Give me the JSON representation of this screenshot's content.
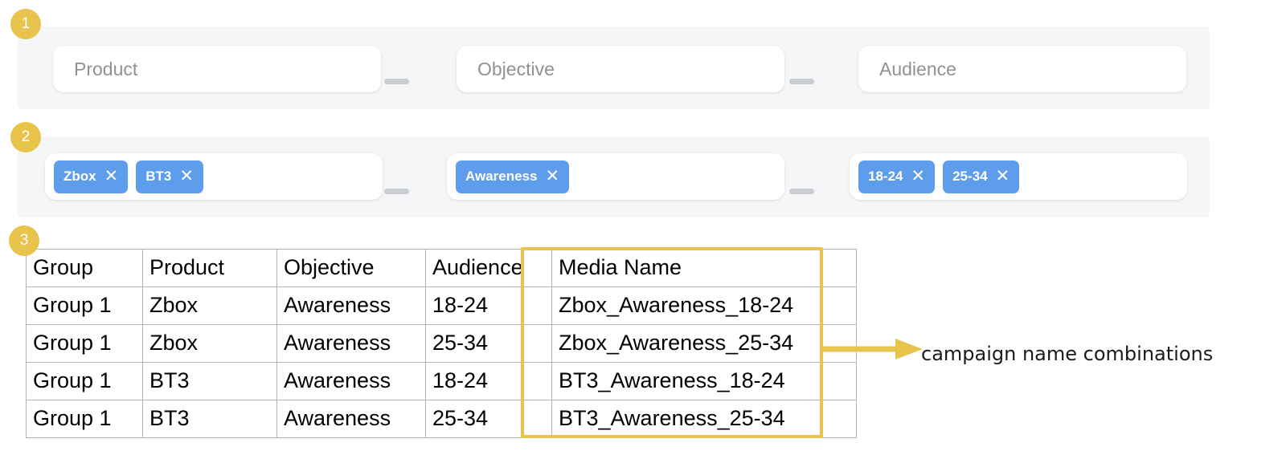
{
  "steps": [
    {
      "number": "1"
    },
    {
      "number": "2"
    },
    {
      "number": "3"
    }
  ],
  "colors": {
    "accent_yellow": "#e8c44c",
    "chip_blue": "#5e9cec",
    "panel_gray": "#f5f6f8",
    "placeholder_gray": "#8e9196",
    "table_border": "#b4b4b4"
  },
  "builder_row_empty": {
    "fields": [
      {
        "name": "product",
        "placeholder": "Product"
      },
      {
        "name": "objective",
        "placeholder": "Objective"
      },
      {
        "name": "audience",
        "placeholder": "Audience"
      }
    ],
    "separator": "—"
  },
  "builder_row_filled": {
    "groups": [
      {
        "name": "product",
        "chips": [
          {
            "label": "Zbox",
            "remove": "✕"
          },
          {
            "label": "BT3",
            "remove": "✕"
          }
        ]
      },
      {
        "name": "objective",
        "chips": [
          {
            "label": "Awareness",
            "remove": "✕"
          }
        ]
      },
      {
        "name": "audience",
        "chips": [
          {
            "label": "18-24",
            "remove": "✕"
          },
          {
            "label": "25-34",
            "remove": "✕"
          }
        ]
      }
    ],
    "separator": "—"
  },
  "table": {
    "headers": [
      "Group",
      "Product",
      "Objective",
      "Audience",
      "Media Name"
    ],
    "rows": [
      [
        "Group 1",
        "Zbox",
        "Awareness",
        "18-24",
        "Zbox_Awareness_18-24"
      ],
      [
        "Group 1",
        "Zbox",
        "Awareness",
        "25-34",
        "Zbox_Awareness_25-34"
      ],
      [
        "Group 1",
        "BT3",
        "Awareness",
        "18-24",
        "BT3_Awareness_18-24"
      ],
      [
        "Group 1",
        "BT3",
        "Awareness",
        "25-34",
        "BT3_Awareness_25-34"
      ]
    ]
  },
  "annotation": {
    "label": "campaign name combinations"
  }
}
